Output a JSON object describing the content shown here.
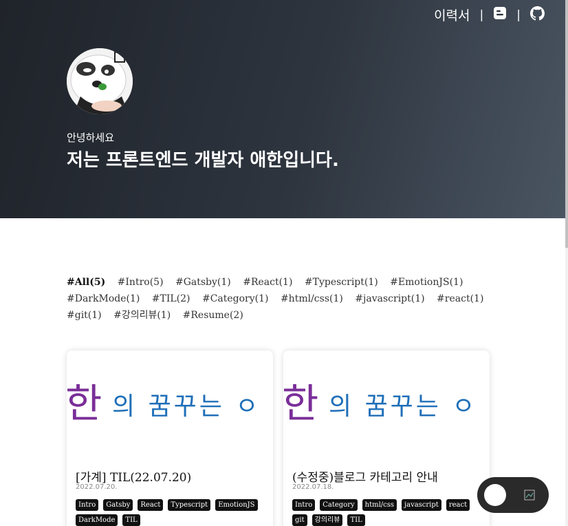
{
  "nav": {
    "resume_label": "이력서",
    "sep1": "|",
    "sep2": "|",
    "blog_icon": "blogger-icon",
    "github_icon": "github-icon"
  },
  "hero": {
    "greeting": "안녕하세요",
    "intro": "저는 프론트엔드 개발자 애한입니다."
  },
  "categories": [
    {
      "label": "#All(5)",
      "active": true
    },
    {
      "label": "#Intro(5)"
    },
    {
      "label": "#Gatsby(1)"
    },
    {
      "label": "#React(1)"
    },
    {
      "label": "#Typescript(1)"
    },
    {
      "label": "#EmotionJS(1)"
    },
    {
      "label": "#DarkMode(1)"
    },
    {
      "label": "#TIL(2)"
    },
    {
      "label": "#Category(1)"
    },
    {
      "label": "#html/css(1)"
    },
    {
      "label": "#javascript(1)"
    },
    {
      "label": "#react(1)"
    },
    {
      "label": "#git(1)"
    },
    {
      "label": "#강의리뷰(1)"
    },
    {
      "label": "#Resume(2)"
    }
  ],
  "posts": [
    {
      "thumb_main": "한",
      "thumb_rest": "의 꿈꾸는 ㅇ",
      "title": "[가계] TIL(22.07.20)",
      "date": "2022.07.20.",
      "tags": [
        "Intro",
        "Gatsby",
        "React",
        "Typescript",
        "EmotionJS",
        "DarkMode",
        "TIL"
      ]
    },
    {
      "thumb_main": "한",
      "thumb_rest": "의 꿈꾸는 ㅇ",
      "title": "(수정중)블로그 카테고리 안내",
      "date": "2022.07.18.",
      "tags": [
        "Intro",
        "Category",
        "html/css",
        "javascript",
        "react",
        "git",
        "강의리뷰",
        "TIL"
      ]
    }
  ],
  "toggle": {
    "icon": "theme-toggle-icon"
  }
}
